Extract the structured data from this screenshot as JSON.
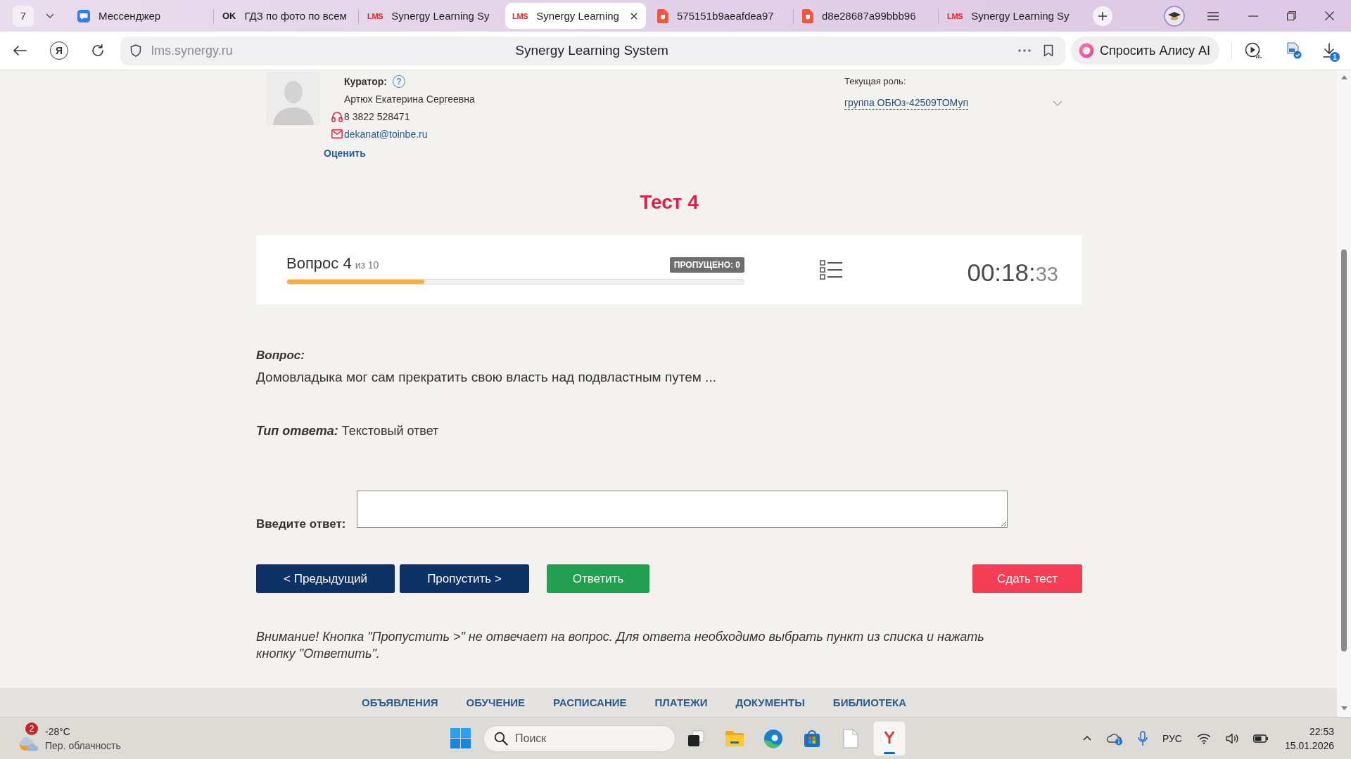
{
  "browser": {
    "tab_counter": "7",
    "tabs": [
      {
        "kind": "messenger",
        "title": "Мессенджер",
        "selected": false
      },
      {
        "kind": "ok",
        "icon_text": "OK",
        "title": "ГДЗ по фото по всем",
        "selected": false
      },
      {
        "kind": "lms",
        "icon_text": "LMS",
        "title": "Synergy Learning Sy",
        "selected": false
      },
      {
        "kind": "lms",
        "icon_text": "LMS",
        "title": "Synergy Learning",
        "selected": true
      },
      {
        "kind": "pdf",
        "title": "575151b9aeafdea97",
        "selected": false
      },
      {
        "kind": "pdf",
        "title": "d8e28687a99bbb96",
        "selected": false
      },
      {
        "kind": "lms",
        "icon_text": "LMS",
        "title": "Synergy Learning Sy",
        "selected": false
      }
    ],
    "home_button": "Я",
    "address": "lms.synergy.ru",
    "page_title": "Synergy Learning System",
    "assistant_button": "Спросить Алису AI",
    "downloads_badge": "1"
  },
  "curator": {
    "label": "Куратор:",
    "help": "?",
    "name": "Артюх Екатерина Сергеевна",
    "phone": "8 3822 528471",
    "email": "dekanat@toinbe.ru",
    "rate_link": "Оценить"
  },
  "role": {
    "label": "Текущая роль:",
    "value": "группа ОБЮз-42509ТОМуп"
  },
  "test": {
    "title": "Тест 4",
    "question_number": "Вопрос 4",
    "question_total": "из 10",
    "progress": {
      "level": 0.3
    },
    "skipped": "ПРОПУЩЕНО: 0",
    "timer": "00:18:",
    "timer_seconds": "33"
  },
  "question": {
    "label": "Вопрос:",
    "text": "Домовладыка мог сам прекратить свою власть над подвластным путем ...",
    "answer_type_label": "Тип ответа:",
    "answer_type": "Текстовый ответ",
    "answer_label": "Введите ответ:"
  },
  "buttons": [
    {
      "kind": "nav",
      "label": "< Предыдущий"
    },
    {
      "kind": "nav",
      "label": "Пропустить >"
    },
    {
      "kind": "answer",
      "label": "Ответить"
    },
    {
      "kind": "finish",
      "label": "Сдать тест"
    }
  ],
  "notice": "Внимание! Кнопка \"Пропустить >\" не отвечает на вопрос. Для ответа необходимо выбрать пункт из списка и нажать кнопку \"Ответить\".",
  "footer_nav": [
    "ОБЪЯВЛЕНИЯ",
    "ОБУЧЕНИЕ",
    "РАСПИСАНИЕ",
    "ПЛАТЕЖИ",
    "ДОКУМЕНТЫ",
    "БИБЛИОТЕКА"
  ],
  "taskbar": {
    "weather": {
      "badge": "2",
      "temperature": "-28°C",
      "condition": "Пер. облачность"
    },
    "search": {
      "placeholder": "Поиск"
    },
    "apps": [
      {
        "kind": "task-view",
        "active": false
      },
      {
        "kind": "folder",
        "active": false
      },
      {
        "kind": "edge",
        "active": false
      },
      {
        "kind": "store",
        "active": false
      },
      {
        "kind": "document",
        "active": false
      },
      {
        "kind": "yandex",
        "active": true
      }
    ],
    "language": "РУС",
    "time": "22:53",
    "date": "15.01.2026"
  }
}
